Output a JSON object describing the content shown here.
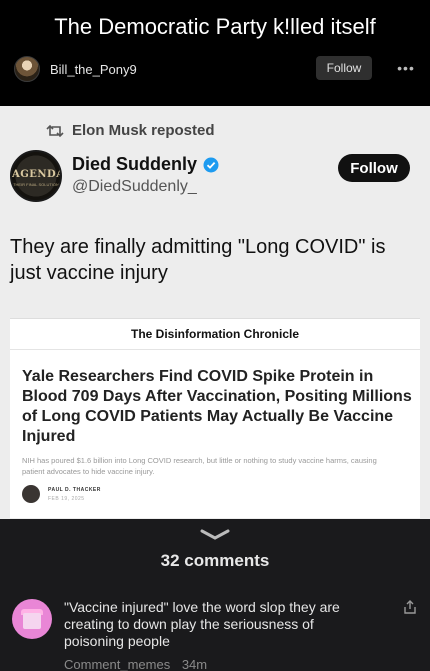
{
  "post": {
    "title": "The Democratic Party k!lled itself",
    "author": "Bill_the_Pony9",
    "follow_label": "Follow",
    "more_label": "•••"
  },
  "screenshot": {
    "repost_text": "Elon Musk reposted",
    "account": {
      "name": "Died Suddenly",
      "handle": "@DiedSuddenly_",
      "avatar_text": "AGENDA",
      "avatar_subtext": "THEIR FINAL SOLUTION",
      "follow_label": "Follow"
    },
    "tweet_text": "They are finally admitting \"Long COVID\" is just vaccine injury",
    "article": {
      "publication": "The Disinformation Chronicle",
      "headline": "Yale Researchers Find COVID Spike Protein in Blood 709 Days After Vaccination, Positing Millions of Long COVID Patients May Actually Be Vaccine Injured",
      "subhead": "NIH has poured $1.6 billion into Long COVID research, but little or nothing to study vaccine harms, causing patient advocates to hide vaccine injury.",
      "author": "PAUL D. THACKER",
      "date": "FEB 19, 2025"
    }
  },
  "comments": {
    "count_label": "32 comments",
    "items": [
      {
        "text": "\"Vaccine injured\" love the word slop they are creating to down play the seriousness of poisoning people",
        "author": "Comment_memes",
        "time": "34m"
      }
    ]
  },
  "colors": {
    "dark_bg": "#000000",
    "comments_bg": "#1a1a1c",
    "screenshot_bg": "#ededed",
    "verified_blue": "#1d9bf0"
  }
}
